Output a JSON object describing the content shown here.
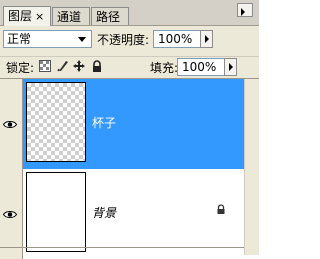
{
  "tabs": [
    {
      "label": "图层"
    },
    {
      "label": "通道"
    },
    {
      "label": "路径"
    }
  ],
  "tab_close_label": "×",
  "blend_mode": {
    "value": "正常"
  },
  "opacity": {
    "label": "不透明度:",
    "value": "100%"
  },
  "lock": {
    "label": "锁定:"
  },
  "fill": {
    "label": "填充:",
    "value": "100%"
  },
  "layers": [
    {
      "name": "杯子",
      "selected": true,
      "visible": true
    },
    {
      "name": "背景",
      "selected": false,
      "visible": true,
      "locked": true
    }
  ],
  "icons": {
    "eye": "eye-icon",
    "lock": "lock-icon",
    "panel_menu": "panel-menu-icon"
  },
  "colors": {
    "selection": "#3399ff",
    "panel_bg": "#ece9d8"
  }
}
